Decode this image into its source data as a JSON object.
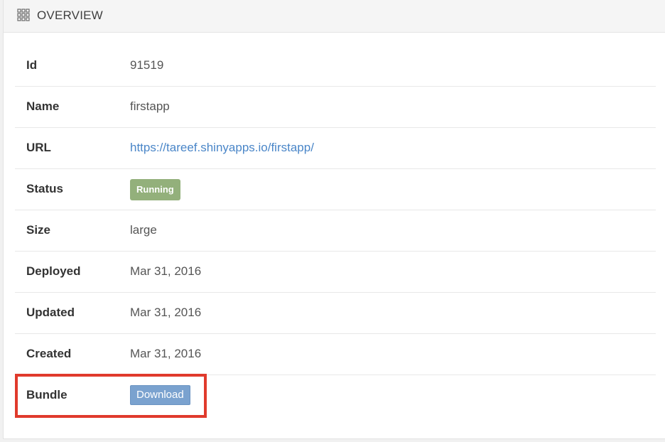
{
  "panel": {
    "title": "OVERVIEW",
    "icon": "grid-icon"
  },
  "rows": [
    {
      "label": "Id",
      "value": "91519"
    },
    {
      "label": "Name",
      "value": "firstapp"
    },
    {
      "label": "URL",
      "value": "https://tareef.shinyapps.io/firstapp/"
    },
    {
      "label": "Status",
      "value": "Running"
    },
    {
      "label": "Size",
      "value": "large"
    },
    {
      "label": "Deployed",
      "value": "Mar 31, 2016"
    },
    {
      "label": "Updated",
      "value": "Mar 31, 2016"
    },
    {
      "label": "Created",
      "value": "Mar 31, 2016"
    },
    {
      "label": "Bundle",
      "value": "Download"
    }
  ],
  "colors": {
    "status_badge": "#93b07b",
    "download_button": "#7aa2cf",
    "link": "#4a86c8",
    "highlight_box": "#e03a2c"
  }
}
